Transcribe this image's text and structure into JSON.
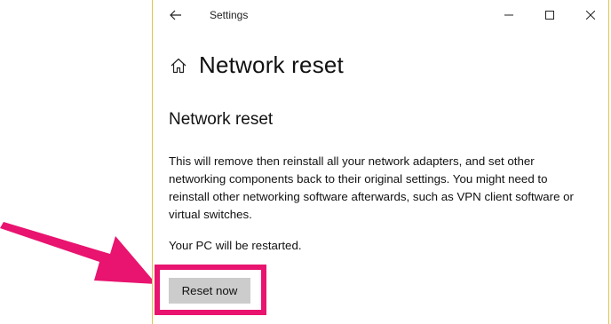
{
  "window": {
    "title": "Settings"
  },
  "page": {
    "title": "Network reset",
    "section_title": "Network reset",
    "description": "This will remove then reinstall all your network adapters, and set other networking components back to their original settings. You might need to reinstall other networking software afterwards, such as VPN client software or virtual switches.",
    "restart_note": "Your PC will be restarted.",
    "reset_button_label": "Reset now"
  },
  "icons": {
    "back": "back-arrow-icon",
    "home": "home-icon",
    "minimize": "minimize-icon",
    "maximize": "maximize-icon",
    "close": "close-icon",
    "annotation_arrow": "pointer-arrow-icon"
  },
  "colors": {
    "window_border": "#e3c34a",
    "highlight": "#e8146f",
    "button_bg": "#cccccc"
  }
}
